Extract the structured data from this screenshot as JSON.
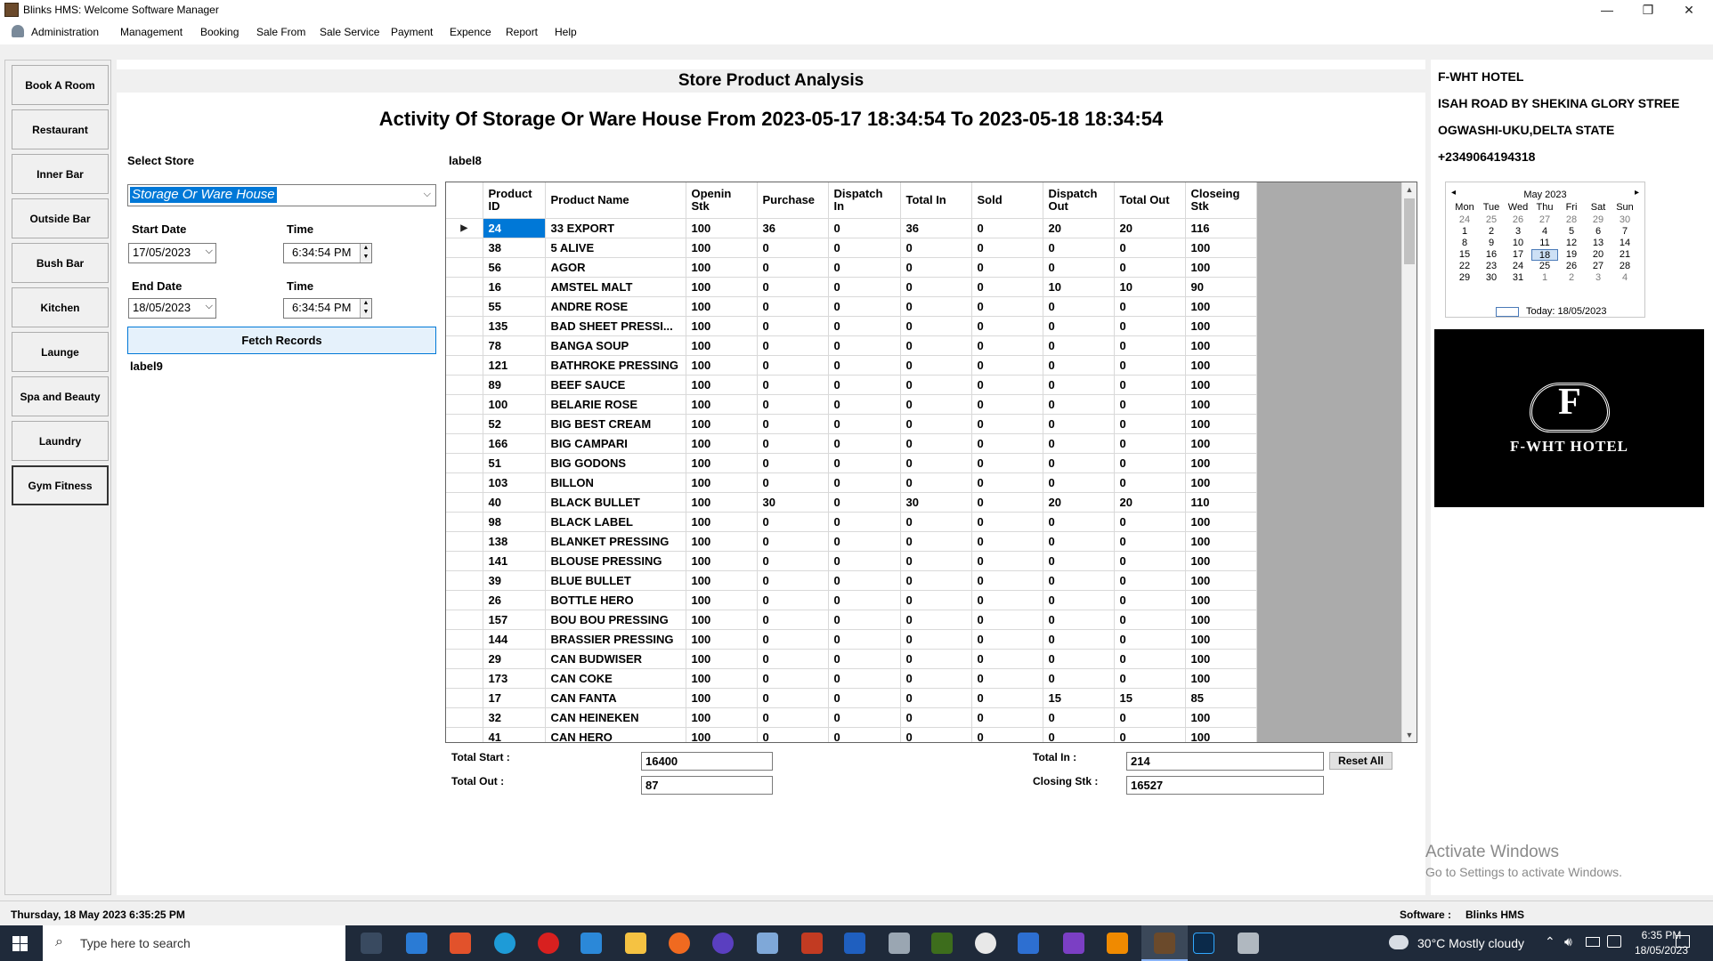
{
  "window": {
    "title": "Blinks HMS: Welcome Software Manager",
    "minimize_glyph": "—",
    "restore_glyph": "❐",
    "close_glyph": "✕"
  },
  "menu": [
    "Administration",
    "Management",
    "Booking",
    "Sale From",
    "Sale Service",
    "Payment",
    "Expence",
    "Report",
    "Help"
  ],
  "nav": [
    "Book A Room",
    "Restaurant",
    "Inner Bar",
    "Outside Bar",
    "Bush Bar",
    "Kitchen",
    "Launge",
    "Spa and Beauty",
    "Laundry",
    "Gym  Fitness"
  ],
  "page": {
    "title": "Store Product Analysis",
    "subtitle": "Activity Of Storage Or Ware House From 2023-05-17 18:34:54 To 2023-05-18 18:34:54"
  },
  "filters": {
    "select_store_label": "Select Store",
    "store_value": "Storage Or Ware House",
    "start_date_label": "Start Date",
    "start_date": "17/05/2023",
    "start_time_label": "Time",
    "start_time": "6:34:54 PM",
    "end_date_label": "End Date",
    "end_date": "18/05/2023",
    "end_time_label": "Time",
    "end_time": "6:34:54 PM",
    "fetch_label": "Fetch Records",
    "label9": "label9",
    "label8": "label8"
  },
  "grid": {
    "columns": [
      "Product ID",
      "Product Name",
      "Openin Stk",
      "Purchase",
      "Dispatch In",
      "Total In",
      "Sold",
      "Dispatch Out",
      "Total Out",
      "Closeing Stk"
    ],
    "current_row_glyph": "▶",
    "rows": [
      [
        "24",
        "33 EXPORT",
        "100",
        "36",
        "0",
        "36",
        "0",
        "20",
        "20",
        "116"
      ],
      [
        "38",
        "5 ALIVE",
        "100",
        "0",
        "0",
        "0",
        "0",
        "0",
        "0",
        "100"
      ],
      [
        "56",
        "AGOR",
        "100",
        "0",
        "0",
        "0",
        "0",
        "0",
        "0",
        "100"
      ],
      [
        "16",
        "AMSTEL MALT",
        "100",
        "0",
        "0",
        "0",
        "0",
        "10",
        "10",
        "90"
      ],
      [
        "55",
        "ANDRE ROSE",
        "100",
        "0",
        "0",
        "0",
        "0",
        "0",
        "0",
        "100"
      ],
      [
        "135",
        "BAD SHEET  PRESSI...",
        "100",
        "0",
        "0",
        "0",
        "0",
        "0",
        "0",
        "100"
      ],
      [
        "78",
        "BANGA SOUP",
        "100",
        "0",
        "0",
        "0",
        "0",
        "0",
        "0",
        "100"
      ],
      [
        "121",
        "BATHROKE PRESSING",
        "100",
        "0",
        "0",
        "0",
        "0",
        "0",
        "0",
        "100"
      ],
      [
        "89",
        "BEEF SAUCE",
        "100",
        "0",
        "0",
        "0",
        "0",
        "0",
        "0",
        "100"
      ],
      [
        "100",
        "BELARIE ROSE",
        "100",
        "0",
        "0",
        "0",
        "0",
        "0",
        "0",
        "100"
      ],
      [
        "52",
        "BIG BEST CREAM",
        "100",
        "0",
        "0",
        "0",
        "0",
        "0",
        "0",
        "100"
      ],
      [
        "166",
        "BIG CAMPARI",
        "100",
        "0",
        "0",
        "0",
        "0",
        "0",
        "0",
        "100"
      ],
      [
        "51",
        "BIG GODONS",
        "100",
        "0",
        "0",
        "0",
        "0",
        "0",
        "0",
        "100"
      ],
      [
        "103",
        "BILLON",
        "100",
        "0",
        "0",
        "0",
        "0",
        "0",
        "0",
        "100"
      ],
      [
        "40",
        "BLACK BULLET",
        "100",
        "30",
        "0",
        "30",
        "0",
        "20",
        "20",
        "110"
      ],
      [
        "98",
        "BLACK LABEL",
        "100",
        "0",
        "0",
        "0",
        "0",
        "0",
        "0",
        "100"
      ],
      [
        "138",
        "BLANKET PRESSING",
        "100",
        "0",
        "0",
        "0",
        "0",
        "0",
        "0",
        "100"
      ],
      [
        "141",
        "BLOUSE PRESSING",
        "100",
        "0",
        "0",
        "0",
        "0",
        "0",
        "0",
        "100"
      ],
      [
        "39",
        "BLUE BULLET",
        "100",
        "0",
        "0",
        "0",
        "0",
        "0",
        "0",
        "100"
      ],
      [
        "26",
        "BOTTLE HERO",
        "100",
        "0",
        "0",
        "0",
        "0",
        "0",
        "0",
        "100"
      ],
      [
        "157",
        "BOU BOU PRESSING",
        "100",
        "0",
        "0",
        "0",
        "0",
        "0",
        "0",
        "100"
      ],
      [
        "144",
        "BRASSIER PRESSING",
        "100",
        "0",
        "0",
        "0",
        "0",
        "0",
        "0",
        "100"
      ],
      [
        "29",
        "CAN BUDWISER",
        "100",
        "0",
        "0",
        "0",
        "0",
        "0",
        "0",
        "100"
      ],
      [
        "173",
        "CAN COKE",
        "100",
        "0",
        "0",
        "0",
        "0",
        "0",
        "0",
        "100"
      ],
      [
        "17",
        "CAN FANTA",
        "100",
        "0",
        "0",
        "0",
        "0",
        "15",
        "15",
        "85"
      ],
      [
        "32",
        "CAN HEINEKEN",
        "100",
        "0",
        "0",
        "0",
        "0",
        "0",
        "0",
        "100"
      ],
      [
        "41",
        "CAN HERO",
        "100",
        "0",
        "0",
        "0",
        "0",
        "0",
        "0",
        "100"
      ]
    ]
  },
  "totals": {
    "total_start_label": "Total Start :",
    "total_start": "16400",
    "total_out_label": "Total Out :",
    "total_out": "87",
    "total_in_label": "Total In :",
    "total_in": "214",
    "closing_label": "Closing Stk :",
    "closing": "16527",
    "reset_label": "Reset All"
  },
  "hotel": {
    "name": "F-WHT HOTEL",
    "address1": "ISAH ROAD BY SHEKINA GLORY STREE",
    "address2": "OGWASHI-UKU,DELTA STATE",
    "phone": "+2349064194318",
    "logo_letter": "F",
    "logo_text": "F-WHT HOTEL"
  },
  "calendar": {
    "month": "May 2023",
    "prev_glyph": "◂",
    "next_glyph": "▸",
    "days": [
      "Mon",
      "Tue",
      "Wed",
      "Thu",
      "Fri",
      "Sat",
      "Sun"
    ],
    "cells": [
      "24",
      "25",
      "26",
      "27",
      "28",
      "29",
      "30",
      "1",
      "2",
      "3",
      "4",
      "5",
      "6",
      "7",
      "8",
      "9",
      "10",
      "11",
      "12",
      "13",
      "14",
      "15",
      "16",
      "17",
      "18",
      "19",
      "20",
      "21",
      "22",
      "23",
      "24",
      "25",
      "26",
      "27",
      "28",
      "29",
      "30",
      "31",
      "1",
      "2",
      "3",
      "4"
    ],
    "today_text": "Today: 18/05/2023"
  },
  "status": {
    "datetime": "Thursday, 18 May 2023 6:35:25 PM",
    "software_label": "Software :",
    "software": "Blinks HMS"
  },
  "watermark": {
    "line1": "Activate Windows",
    "line2": "Go to Settings to activate Windows."
  },
  "taskbar": {
    "search_placeholder": "Type here to search",
    "weather": "30°C  Mostly cloudy",
    "time": "6:35 PM",
    "date": "18/05/2023"
  }
}
